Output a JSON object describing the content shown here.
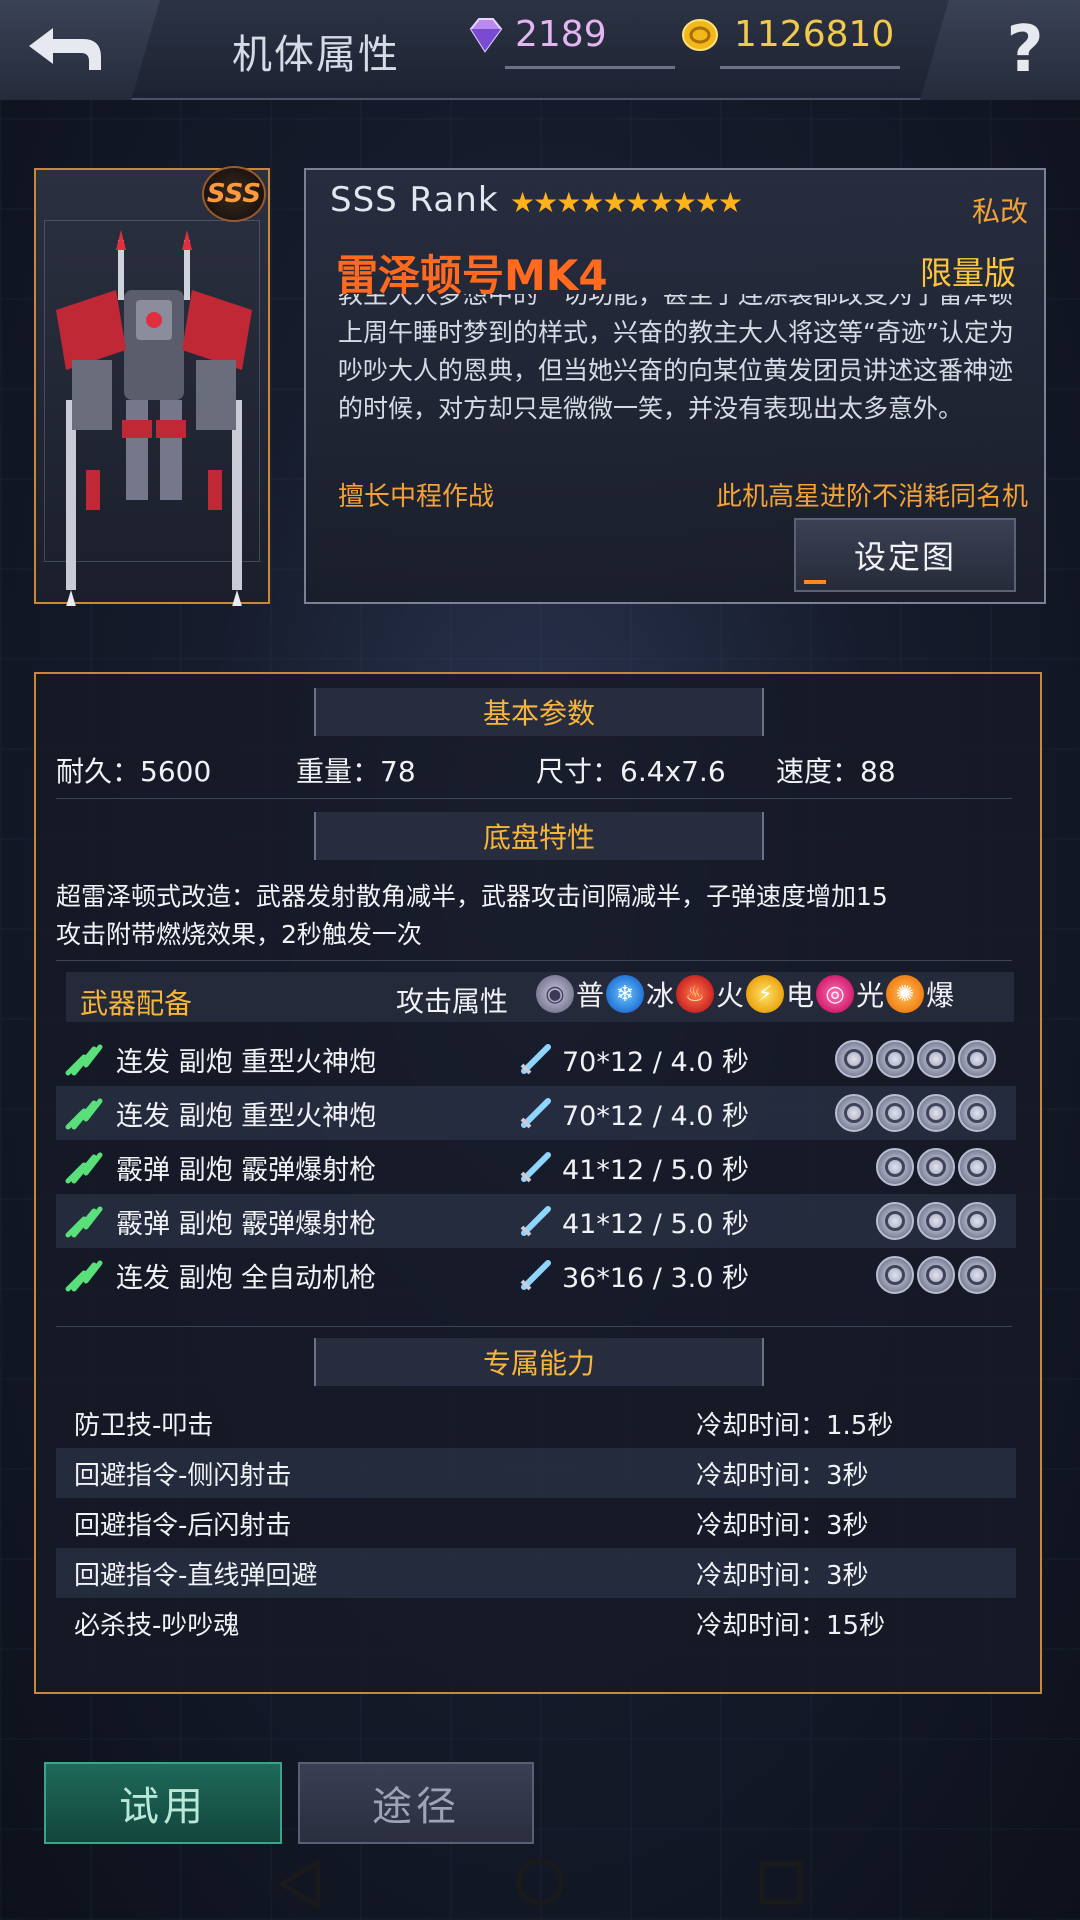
{
  "header": {
    "title": "机体属性",
    "gems": "2189",
    "gold": "1126810"
  },
  "mech": {
    "rank_badge": "SSS",
    "rank_text": "SSS Rank",
    "stars": "★★★★★★★★★★",
    "star_count": 10,
    "private_tag": "私改",
    "name": "雷泽顿号MK4",
    "limited_tag": "限量版",
    "description": "教主大人梦想中的一切功能，甚至于连涂装都改变为了雷泽顿上周午睡时梦到的样式，兴奋的教主大人将这等“奇迹”认定为吵吵大人的恩典，但当她兴奋的向某位黄发团员讲述这番神迹的时候，对方却只是微微一笑，并没有表现出太多意外。",
    "specialty": "擅长中程作战",
    "note": "此机高星进阶不消耗同名机",
    "setting_button": "设定图"
  },
  "basic": {
    "header": "基本参数",
    "durability": "耐久：5600",
    "weight": "重量：78",
    "size": "尺寸：6.4x7.6",
    "speed": "速度：88"
  },
  "chassis": {
    "header": "底盘特性",
    "line1": "超雷泽顿式改造：武器发射散角减半，武器攻击间隔减半，子弹速度增加15",
    "line2": "攻击附带燃烧效果，2秒触发一次"
  },
  "weapons": {
    "header": "武器配备",
    "attr_label": "攻击属性",
    "elements": [
      "普",
      "冰",
      "火",
      "电",
      "光",
      "爆"
    ],
    "items": [
      {
        "name": "连发 副炮  重型火神炮",
        "damage": "70*12 / 4.0 秒",
        "slots": 4
      },
      {
        "name": "连发 副炮  重型火神炮",
        "damage": "70*12 / 4.0 秒",
        "slots": 4
      },
      {
        "name": "霰弹 副炮  霰弹爆射枪",
        "damage": "41*12 / 5.0 秒",
        "slots": 3
      },
      {
        "name": "霰弹 副炮  霰弹爆射枪",
        "damage": "41*12 / 5.0 秒",
        "slots": 3
      },
      {
        "name": "连发 副炮  全自动机枪",
        "damage": "36*16 / 3.0 秒",
        "slots": 3
      }
    ]
  },
  "skills": {
    "header": "专属能力",
    "items": [
      {
        "name": "防卫技-叩击",
        "cooldown": "冷却时间：1.5秒"
      },
      {
        "name": "回避指令-侧闪射击",
        "cooldown": "冷却时间：3秒"
      },
      {
        "name": "回避指令-后闪射击",
        "cooldown": "冷却时间：3秒"
      },
      {
        "name": "回避指令-直线弹回避",
        "cooldown": "冷却时间：3秒"
      },
      {
        "name": "必杀技-吵吵魂",
        "cooldown": "冷却时间：15秒"
      }
    ]
  },
  "actions": {
    "try_label": "试用",
    "route_label": "途径"
  },
  "colors": {
    "accent_orange": "#f7b63a",
    "name_red": "#ff6a1f",
    "frame_gold": "#c8883a",
    "try_green": "#1f6a5a"
  }
}
